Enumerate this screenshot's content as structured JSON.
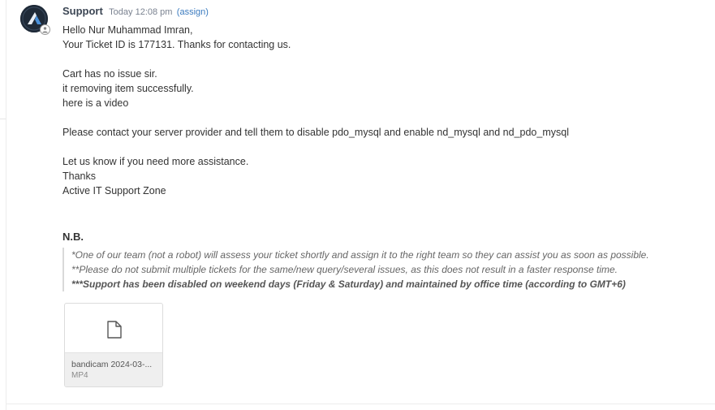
{
  "message": {
    "author": "Support",
    "timestamp": "Today 12:08 pm",
    "assign_label": "(assign)",
    "body_lines": [
      "Hello Nur Muhammad Imran,",
      "Your Ticket ID is 177131. Thanks for contacting us.",
      "",
      "Cart has no issue sir.",
      "it removing item successfully.",
      "here is a video",
      "",
      "Please contact your server provider and tell them to disable pdo_mysql and enable nd_mysql and nd_pdo_mysql",
      "",
      "Let us know if you need more assistance.",
      "Thanks",
      "Active IT Support Zone"
    ]
  },
  "nb": {
    "title": "N.B.",
    "lines": [
      "*One of our team (not a robot) will assess your ticket shortly and assign it to the right team so they can assist you as soon as possible.",
      "**Please do not submit multiple tickets for the same/new query/several issues, as this does not result in a faster response time."
    ],
    "strong_line": "***Support has been disabled on weekend days (Friday & Saturday) and maintained by office time (according to GMT+6)"
  },
  "attachment": {
    "file_name": "bandicam 2024-03-...",
    "file_type": "MP4",
    "icon": "file-icon"
  },
  "colors": {
    "avatar_bg": "#1f2a38",
    "link": "#3b7bbf"
  }
}
